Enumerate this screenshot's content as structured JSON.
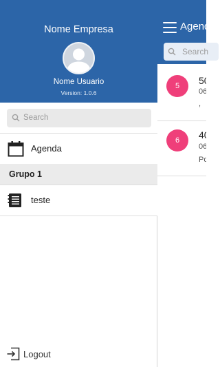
{
  "drawer": {
    "company_name": "Nome Empresa",
    "user_name": "Nome Usuario",
    "version": "Version: 1.0.6",
    "search_placeholder": "Search",
    "items": [
      {
        "label": "Agenda",
        "icon": "calendar-icon"
      },
      {
        "label": "teste",
        "icon": "document-list-icon"
      }
    ],
    "group_label": "Grupo 1",
    "logout_label": "Logout"
  },
  "main": {
    "title": "Agenda",
    "search_placeholder": "Search",
    "cards": [
      {
        "badge": "5",
        "title": "50",
        "subtitle": "06",
        "extra": ","
      },
      {
        "badge": "6",
        "title": "40",
        "subtitle": "06",
        "extra": "Po"
      }
    ]
  },
  "colors": {
    "header_blue": "#2c65a8",
    "badge_pink": "#ef3f7a",
    "group_bg": "#ebebeb"
  }
}
